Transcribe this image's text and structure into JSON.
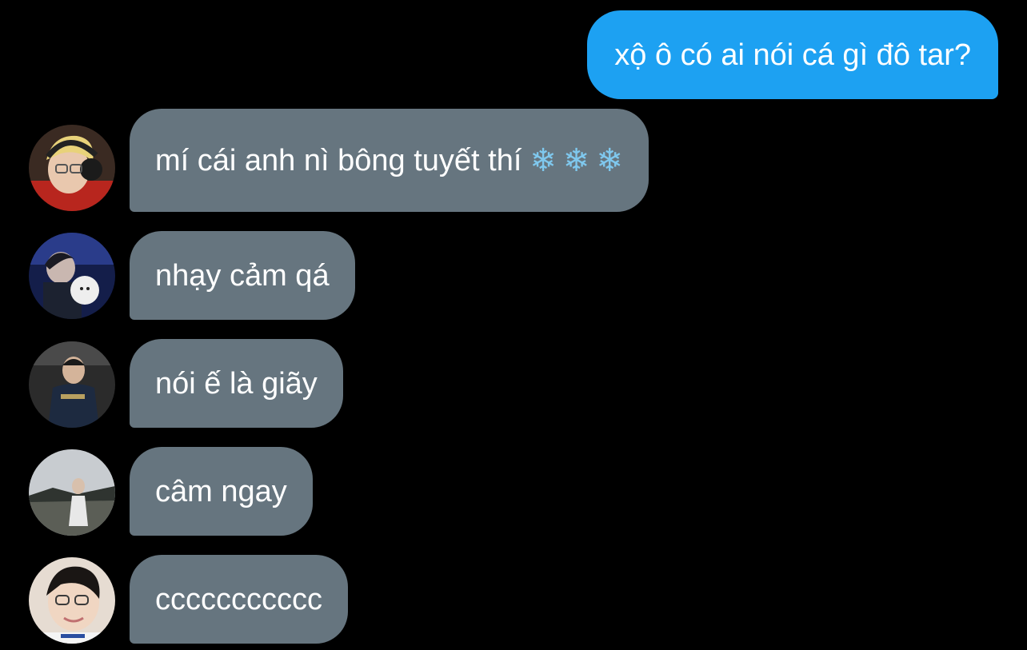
{
  "conversation": {
    "sent_message": "xộ ô có ai nói cá gì đô tar?",
    "received": [
      {
        "text": "mí cái anh nì bông tuyết thí",
        "emoji": [
          "❄",
          "❄",
          "❄"
        ]
      },
      {
        "text": "nhạy cảm qá"
      },
      {
        "text": "nói ế là giãy"
      },
      {
        "text": "câm ngay"
      },
      {
        "text": "ccccccccccc"
      }
    ]
  },
  "colors": {
    "background": "#000000",
    "sent_bubble": "#1da1f2",
    "received_bubble": "#66757f",
    "text": "#ffffff"
  }
}
